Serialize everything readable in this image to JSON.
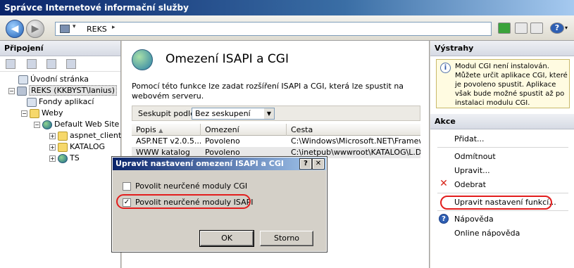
{
  "window": {
    "title": "Správce Internetové informační služby"
  },
  "toolbar": {
    "address": "REKS",
    "icons": [
      "back-arrow-icon",
      "forward-arrow-icon",
      "server-icon",
      "refresh-icon",
      "mail-icon",
      "home-icon",
      "help-icon"
    ]
  },
  "connections": {
    "title": "Připojení",
    "tree": [
      {
        "label": "Úvodní stránka",
        "icon": "home-page-icon"
      },
      {
        "label": "REKS (KKBYST\\lanius)",
        "icon": "server-icon",
        "selected": true
      },
      {
        "label": "Fondy aplikací",
        "icon": "app-pool-icon"
      },
      {
        "label": "Weby",
        "icon": "sites-folder-icon"
      },
      {
        "label": "Default Web Site",
        "icon": "globe-icon"
      },
      {
        "label": "aspnet_client",
        "icon": "folder-icon"
      },
      {
        "label": "KATALOG",
        "icon": "folder-icon"
      },
      {
        "label": "TS",
        "icon": "globe-icon"
      }
    ]
  },
  "feature": {
    "title": "Omezení ISAPI a CGI",
    "description": "Pomocí této funkce lze zadat rozšíření ISAPI a CGI, která lze spustit na webovém serveru.",
    "group_label": "Seskupit podle:",
    "group_value": "Bez seskupení",
    "columns": [
      "Popis",
      "Omezení",
      "Cesta"
    ],
    "rows": [
      {
        "popis": "ASP.NET v2.0.5...",
        "omezeni": "Povoleno",
        "cesta": "C:\\Windows\\Microsoft.NET\\Framework"
      },
      {
        "popis": "WWW katalog",
        "omezeni": "Povoleno",
        "cesta": "C:\\inetpub\\wwwroot\\KATALOG\\L.DLL"
      }
    ]
  },
  "alerts": {
    "title": "Výstrahy",
    "message": "Modul CGI není instalován. Můžete určit aplikace CGI, které je povoleno spustit. Aplikace však bude možné spustit až po instalaci modulu CGI."
  },
  "actions": {
    "title": "Akce",
    "add": "Přidat...",
    "remove": "Odmítnout",
    "edit": "Upravit...",
    "delete": "Odebrat",
    "edit_feature_settings": "Upravit nastavení funkcí...",
    "help": "Nápověda",
    "online_help": "Online nápověda"
  },
  "dialog": {
    "title": "Upravit nastavení omezení ISAPI a CGI",
    "help_btn": "?",
    "close_btn": "✕",
    "chk_cgi": {
      "label": "Povolit neurčené moduly CGI",
      "checked": false
    },
    "chk_isapi": {
      "label": "Povolit neurčené moduly ISAPI",
      "checked": true
    },
    "ok": "OK",
    "cancel": "Storno"
  },
  "colors": {
    "highlight_red": "#e21d1d",
    "title_blue": "#0a246a"
  }
}
